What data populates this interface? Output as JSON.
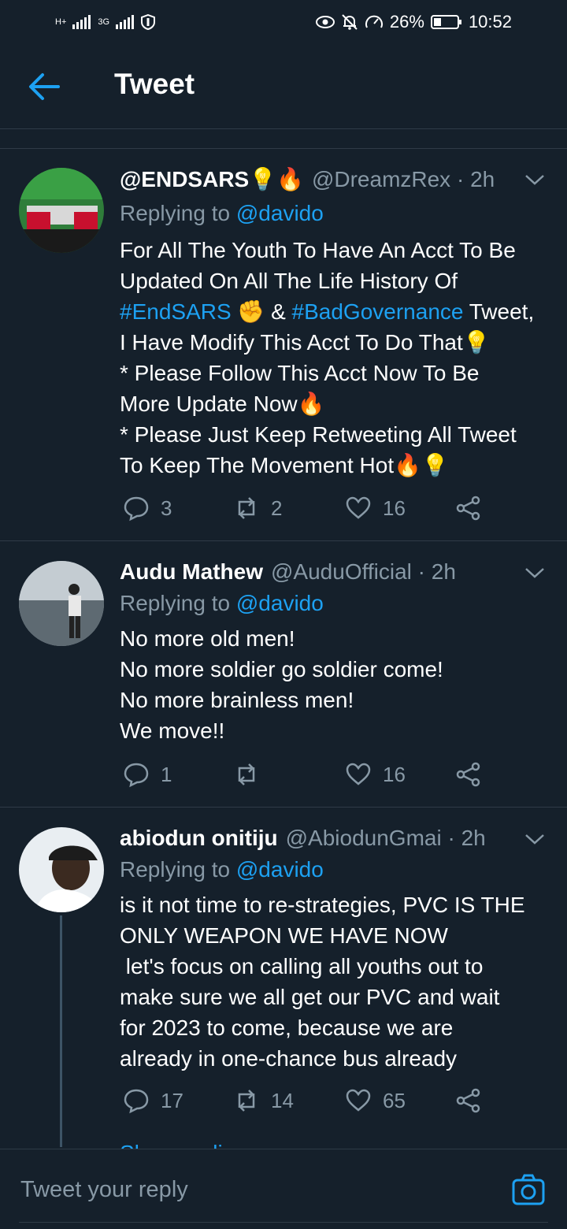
{
  "status_bar": {
    "network_left": "H+",
    "network_right": "3G",
    "battery": "26%",
    "time": "10:52"
  },
  "header": {
    "title": "Tweet"
  },
  "tweets": [
    {
      "name": "@ENDSARS💡🔥",
      "handle": "@DreamzRex · 2h",
      "reply_prefix": "Replying to ",
      "reply_to": "@davido",
      "body_lines": [
        "For All The Youth To Have An Acct To Be",
        "Updated On All The Life History Of"
      ],
      "line3_hashtag1": "#EndSARS",
      "line3_mid": "✊ & ",
      "line3_hashtag2": "#BadGovernance",
      "line3_end": " Tweet,",
      "body_lines_after": [
        "I Have Modify This Acct To Do That💡",
        "* Please Follow This Acct Now To Be",
        "More Update Now🔥",
        "* Please Just Keep Retweeting All Tweet",
        "To Keep The Movement Hot🔥💡"
      ],
      "replies": "3",
      "retweets": "2",
      "likes": "16"
    },
    {
      "name": "Audu Mathew",
      "handle": "@AuduOfficial · 2h",
      "reply_prefix": "Replying to ",
      "reply_to": "@davido",
      "body_lines": [
        "No more old men!",
        "No more soldier go soldier come!",
        "No more brainless men!",
        "We move!!"
      ],
      "replies": "1",
      "retweets": "",
      "likes": "16"
    },
    {
      "name": "abiodun onitiju",
      "handle": "@AbiodunGmai · 2h",
      "reply_prefix": "Replying to ",
      "reply_to": "@davido",
      "body_lines": [
        "is it not time to re-strategies, PVC IS THE",
        "ONLY WEAPON WE HAVE NOW",
        " let's focus on calling all youths out to",
        "make sure we all get our PVC and wait",
        "for 2023 to come, because we are",
        "already in one-chance bus already"
      ],
      "replies": "17",
      "retweets": "14",
      "likes": "65"
    }
  ],
  "show_replies": "Show replies",
  "reply_bar": {
    "placeholder": "Tweet your reply"
  },
  "colors": {
    "background": "#15202b",
    "accent": "#1da1f2",
    "muted": "#8899a6",
    "divider": "#2f3b47"
  }
}
